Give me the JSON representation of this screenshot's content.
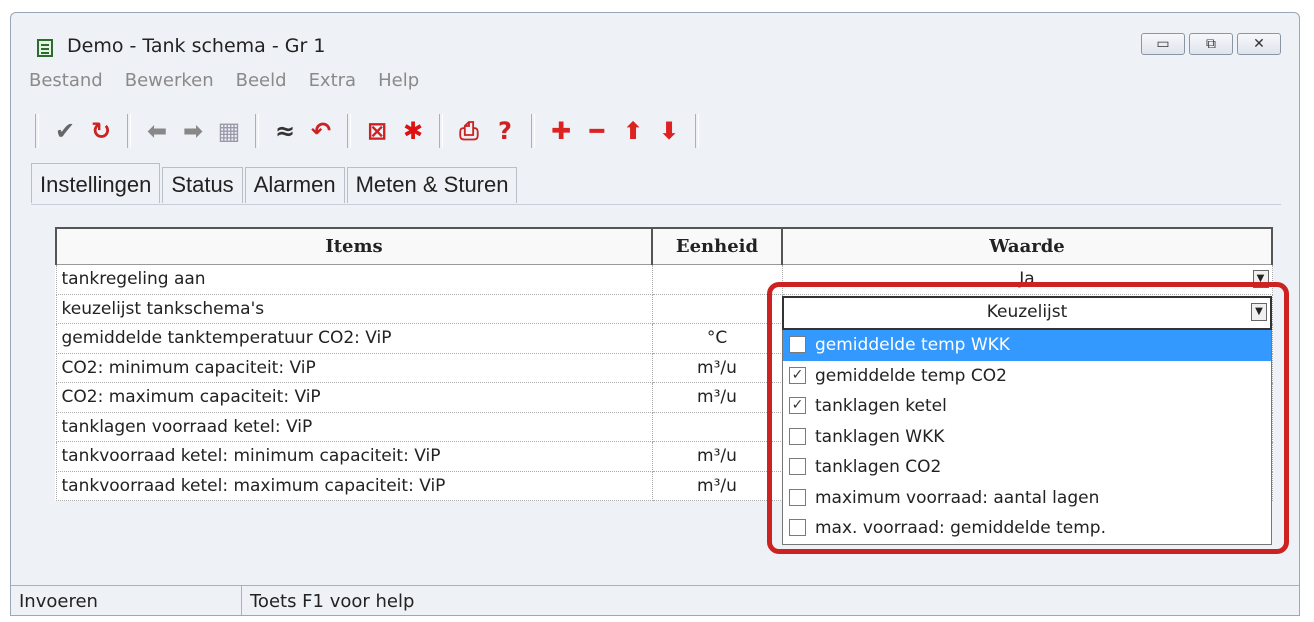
{
  "window": {
    "title": "Demo - Tank schema - Gr 1",
    "controls": [
      "▭",
      "⧉",
      "✕"
    ]
  },
  "menu": [
    "Bestand",
    "Bewerken",
    "Beeld",
    "Extra",
    "Help"
  ],
  "toolbar": {
    "buttons": [
      {
        "icon": "check-icon",
        "glyph": "✔",
        "color": "#666666"
      },
      {
        "icon": "refresh-icon",
        "glyph": "↻",
        "color": "#cc2222"
      },
      {
        "icon": "back-icon",
        "glyph": "⬅",
        "color": "#888888"
      },
      {
        "icon": "forward-icon",
        "glyph": "➡",
        "color": "#888888"
      },
      {
        "icon": "grid-icon",
        "glyph": "▦",
        "color": "#9999aa"
      },
      {
        "icon": "collapse-icon",
        "glyph": "≈",
        "color": "#333333"
      },
      {
        "icon": "undo-icon",
        "glyph": "↶",
        "color": "#cc2222"
      },
      {
        "icon": "cancel-box-icon",
        "glyph": "⊠",
        "color": "#cc2222"
      },
      {
        "icon": "asterisk-icon",
        "glyph": "✱",
        "color": "#dd1111"
      },
      {
        "icon": "print-icon",
        "glyph": "⎙",
        "color": "#cc2222"
      },
      {
        "icon": "help-icon",
        "glyph": "?",
        "color": "#cc2222"
      },
      {
        "icon": "add-icon",
        "glyph": "✚",
        "color": "#dd2222"
      },
      {
        "icon": "remove-icon",
        "glyph": "━",
        "color": "#dd2222"
      },
      {
        "icon": "up-icon",
        "glyph": "⬆",
        "color": "#dd2222"
      },
      {
        "icon": "down-icon",
        "glyph": "⬇",
        "color": "#dd2222"
      }
    ]
  },
  "tabs": [
    "Instellingen",
    "Status",
    "Alarmen",
    "Meten & Sturen"
  ],
  "table": {
    "headers": {
      "items": "Items",
      "unit": "Eenheid",
      "value": "Waarde"
    },
    "rows": [
      {
        "item": "tankregeling aan",
        "unit": "",
        "value": "Ja"
      },
      {
        "item": "keuzelijst tankschema's",
        "unit": "",
        "value": "Keuzelijst"
      },
      {
        "item": "gemiddelde tanktemperatuur CO2: ViP",
        "unit": "°C",
        "value": ""
      },
      {
        "item": "CO2: minimum capaciteit: ViP",
        "unit": "m³/u",
        "value": ""
      },
      {
        "item": "CO2: maximum capaciteit: ViP",
        "unit": "m³/u",
        "value": ""
      },
      {
        "item": "tanklagen voorraad ketel: ViP",
        "unit": "",
        "value": ""
      },
      {
        "item": "tankvoorraad ketel: minimum capaciteit: ViP",
        "unit": "m³/u",
        "value": ""
      },
      {
        "item": "tankvoorraad ketel: maximum capaciteit: ViP",
        "unit": "m³/u",
        "value": ""
      }
    ]
  },
  "dropdown": {
    "header": "Keuzelijst",
    "options": [
      {
        "label": "gemiddelde temp WKK",
        "checked": false,
        "selected": true
      },
      {
        "label": "gemiddelde temp CO2",
        "checked": true,
        "selected": false
      },
      {
        "label": "tanklagen ketel",
        "checked": true,
        "selected": false
      },
      {
        "label": "tanklagen WKK",
        "checked": false,
        "selected": false
      },
      {
        "label": "tanklagen CO2",
        "checked": false,
        "selected": false
      },
      {
        "label": "maximum voorraad: aantal lagen",
        "checked": false,
        "selected": false
      },
      {
        "label": "max. voorraad: gemiddelde temp.",
        "checked": false,
        "selected": false
      }
    ]
  },
  "statusbar": {
    "mode": "Invoeren",
    "hint": "Toets F1 voor help"
  },
  "colors": {
    "selection": "#3399ff",
    "highlight": "#cc2222"
  }
}
